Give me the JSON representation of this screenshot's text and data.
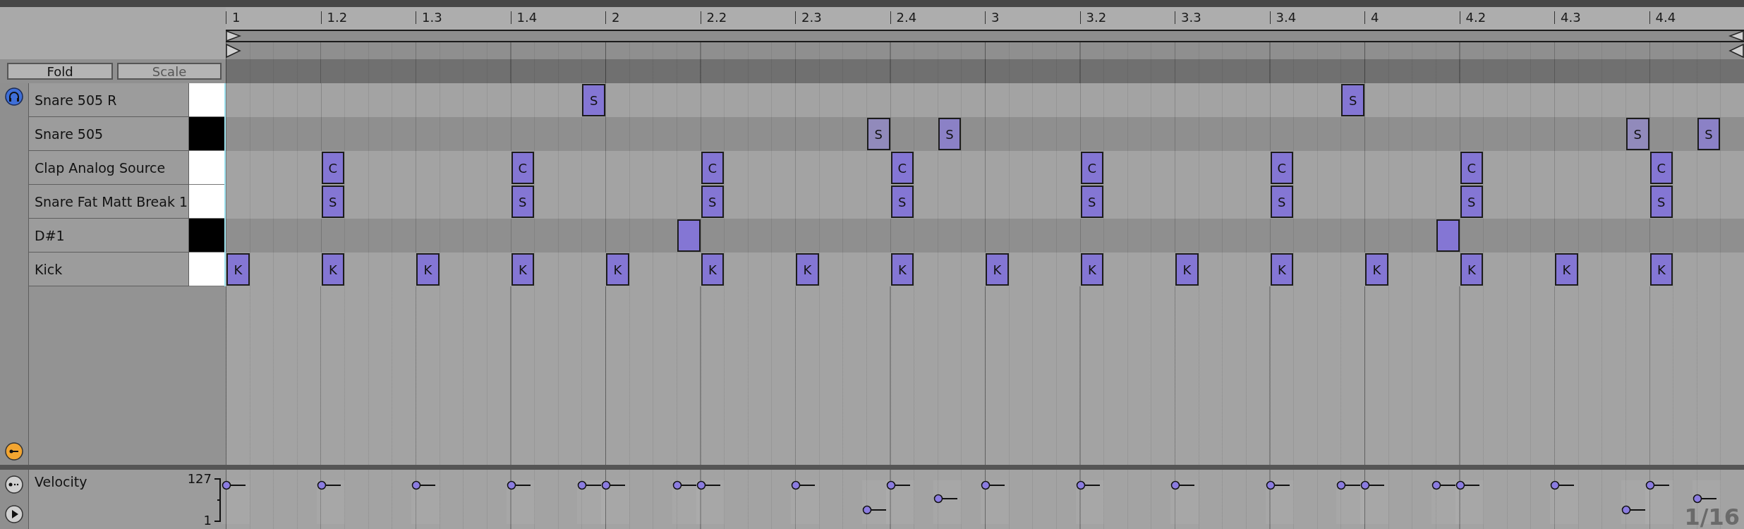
{
  "toolbar": {
    "fold_button": "Fold",
    "scale_button": "Scale"
  },
  "ruler": {
    "labels": [
      "1",
      "1.2",
      "1.3",
      "1.4",
      "2",
      "2.2",
      "2.3",
      "2.4",
      "3",
      "3.2",
      "3.3",
      "3.4",
      "4",
      "4.2",
      "4.3",
      "4.4"
    ]
  },
  "rows": [
    {
      "name": "Snare 505 R",
      "black_key": false,
      "steps": [
        {
          "note": false
        },
        {
          "note": false
        },
        {
          "note": false
        },
        {
          "note": false
        },
        {
          "note": false
        },
        {
          "note": false
        },
        {
          "note": false
        },
        {
          "note": false
        },
        {
          "note": false
        },
        {
          "note": false
        },
        {
          "note": false
        },
        {
          "note": false
        },
        {
          "note": false
        },
        {
          "note": false
        },
        {
          "note": false
        },
        {
          "note": true,
          "label": "S",
          "level": 1
        },
        {
          "note": false
        },
        {
          "note": false
        },
        {
          "note": false
        },
        {
          "note": false
        },
        {
          "note": false
        },
        {
          "note": false
        },
        {
          "note": false
        },
        {
          "note": false
        },
        {
          "note": false
        },
        {
          "note": false
        },
        {
          "note": false
        },
        {
          "note": false
        },
        {
          "note": false
        },
        {
          "note": false
        },
        {
          "note": false
        },
        {
          "note": false
        },
        {
          "note": false
        },
        {
          "note": false
        },
        {
          "note": false
        },
        {
          "note": false
        },
        {
          "note": false
        },
        {
          "note": false
        },
        {
          "note": false
        },
        {
          "note": false
        },
        {
          "note": false
        },
        {
          "note": false
        },
        {
          "note": false
        },
        {
          "note": false
        },
        {
          "note": false
        },
        {
          "note": false
        },
        {
          "note": false
        },
        {
          "note": true,
          "label": "S",
          "level": 1
        },
        {
          "note": false
        },
        {
          "note": false
        },
        {
          "note": false
        },
        {
          "note": false
        },
        {
          "note": false
        },
        {
          "note": false
        },
        {
          "note": false
        },
        {
          "note": false
        },
        {
          "note": false
        },
        {
          "note": false
        },
        {
          "note": false
        },
        {
          "note": false
        },
        {
          "note": false
        },
        {
          "note": false
        },
        {
          "note": false
        },
        {
          "note": false
        }
      ]
    },
    {
      "name": "Snare 505",
      "black_key": true,
      "steps": [
        {
          "note": false
        },
        {
          "note": false
        },
        {
          "note": false
        },
        {
          "note": false
        },
        {
          "note": false
        },
        {
          "note": false
        },
        {
          "note": false
        },
        {
          "note": false
        },
        {
          "note": false
        },
        {
          "note": false
        },
        {
          "note": false
        },
        {
          "note": false
        },
        {
          "note": false
        },
        {
          "note": false
        },
        {
          "note": false
        },
        {
          "note": false
        },
        {
          "note": false
        },
        {
          "note": false
        },
        {
          "note": false
        },
        {
          "note": false
        },
        {
          "note": false
        },
        {
          "note": false
        },
        {
          "note": false
        },
        {
          "note": false
        },
        {
          "note": false
        },
        {
          "note": false
        },
        {
          "note": false
        },
        {
          "note": true,
          "label": "S",
          "level": 0.27
        },
        {
          "note": false
        },
        {
          "note": false
        },
        {
          "note": true,
          "label": "S",
          "level": 0.6
        },
        {
          "note": false
        },
        {
          "note": false
        },
        {
          "note": false
        },
        {
          "note": false
        },
        {
          "note": false
        },
        {
          "note": false
        },
        {
          "note": false
        },
        {
          "note": false
        },
        {
          "note": false
        },
        {
          "note": false
        },
        {
          "note": false
        },
        {
          "note": false
        },
        {
          "note": false
        },
        {
          "note": false
        },
        {
          "note": false
        },
        {
          "note": false
        },
        {
          "note": false
        },
        {
          "note": false
        },
        {
          "note": false
        },
        {
          "note": false
        },
        {
          "note": false
        },
        {
          "note": false
        },
        {
          "note": false
        },
        {
          "note": false
        },
        {
          "note": false
        },
        {
          "note": false
        },
        {
          "note": false
        },
        {
          "note": false
        },
        {
          "note": true,
          "label": "S",
          "level": 0.27
        },
        {
          "note": false
        },
        {
          "note": false
        },
        {
          "note": true,
          "label": "S",
          "level": 0.6
        },
        {
          "note": false
        }
      ]
    },
    {
      "name": "Clap Analog Source",
      "black_key": false,
      "steps": [
        {
          "note": false
        },
        {
          "note": false
        },
        {
          "note": false
        },
        {
          "note": false
        },
        {
          "note": true,
          "label": "C",
          "level": 1
        },
        {
          "note": false
        },
        {
          "note": false
        },
        {
          "note": false
        },
        {
          "note": false
        },
        {
          "note": false
        },
        {
          "note": false
        },
        {
          "note": false
        },
        {
          "note": true,
          "label": "C",
          "level": 1
        },
        {
          "note": false
        },
        {
          "note": false
        },
        {
          "note": false
        },
        {
          "note": false
        },
        {
          "note": false
        },
        {
          "note": false
        },
        {
          "note": false
        },
        {
          "note": true,
          "label": "C",
          "level": 1
        },
        {
          "note": false
        },
        {
          "note": false
        },
        {
          "note": false
        },
        {
          "note": false
        },
        {
          "note": false
        },
        {
          "note": false
        },
        {
          "note": false
        },
        {
          "note": true,
          "label": "C",
          "level": 1
        },
        {
          "note": false
        },
        {
          "note": false
        },
        {
          "note": false
        },
        {
          "note": false
        },
        {
          "note": false
        },
        {
          "note": false
        },
        {
          "note": false
        },
        {
          "note": true,
          "label": "C",
          "level": 1
        },
        {
          "note": false
        },
        {
          "note": false
        },
        {
          "note": false
        },
        {
          "note": false
        },
        {
          "note": false
        },
        {
          "note": false
        },
        {
          "note": false
        },
        {
          "note": true,
          "label": "C",
          "level": 1
        },
        {
          "note": false
        },
        {
          "note": false
        },
        {
          "note": false
        },
        {
          "note": false
        },
        {
          "note": false
        },
        {
          "note": false
        },
        {
          "note": false
        },
        {
          "note": true,
          "label": "C",
          "level": 1
        },
        {
          "note": false
        },
        {
          "note": false
        },
        {
          "note": false
        },
        {
          "note": false
        },
        {
          "note": false
        },
        {
          "note": false
        },
        {
          "note": false
        },
        {
          "note": true,
          "label": "C",
          "level": 1
        },
        {
          "note": false
        },
        {
          "note": false
        },
        {
          "note": false
        }
      ]
    },
    {
      "name": "Snare Fat Matt Break 1",
      "black_key": false,
      "steps": [
        {
          "note": false
        },
        {
          "note": false
        },
        {
          "note": false
        },
        {
          "note": false
        },
        {
          "note": true,
          "label": "S",
          "level": 1
        },
        {
          "note": false
        },
        {
          "note": false
        },
        {
          "note": false
        },
        {
          "note": false
        },
        {
          "note": false
        },
        {
          "note": false
        },
        {
          "note": false
        },
        {
          "note": true,
          "label": "S",
          "level": 1
        },
        {
          "note": false
        },
        {
          "note": false
        },
        {
          "note": false
        },
        {
          "note": false
        },
        {
          "note": false
        },
        {
          "note": false
        },
        {
          "note": false
        },
        {
          "note": true,
          "label": "S",
          "level": 1
        },
        {
          "note": false
        },
        {
          "note": false
        },
        {
          "note": false
        },
        {
          "note": false
        },
        {
          "note": false
        },
        {
          "note": false
        },
        {
          "note": false
        },
        {
          "note": true,
          "label": "S",
          "level": 1
        },
        {
          "note": false
        },
        {
          "note": false
        },
        {
          "note": false
        },
        {
          "note": false
        },
        {
          "note": false
        },
        {
          "note": false
        },
        {
          "note": false
        },
        {
          "note": true,
          "label": "S",
          "level": 1
        },
        {
          "note": false
        },
        {
          "note": false
        },
        {
          "note": false
        },
        {
          "note": false
        },
        {
          "note": false
        },
        {
          "note": false
        },
        {
          "note": false
        },
        {
          "note": true,
          "label": "S",
          "level": 1
        },
        {
          "note": false
        },
        {
          "note": false
        },
        {
          "note": false
        },
        {
          "note": false
        },
        {
          "note": false
        },
        {
          "note": false
        },
        {
          "note": false
        },
        {
          "note": true,
          "label": "S",
          "level": 1
        },
        {
          "note": false
        },
        {
          "note": false
        },
        {
          "note": false
        },
        {
          "note": false
        },
        {
          "note": false
        },
        {
          "note": false
        },
        {
          "note": false
        },
        {
          "note": true,
          "label": "S",
          "level": 1
        },
        {
          "note": false
        },
        {
          "note": false
        },
        {
          "note": false
        }
      ]
    },
    {
      "name": "D#1",
      "black_key": true,
      "steps": [
        {
          "note": false
        },
        {
          "note": false
        },
        {
          "note": false
        },
        {
          "note": false
        },
        {
          "note": false
        },
        {
          "note": false
        },
        {
          "note": false
        },
        {
          "note": false
        },
        {
          "note": false
        },
        {
          "note": false
        },
        {
          "note": false
        },
        {
          "note": false
        },
        {
          "note": false
        },
        {
          "note": false
        },
        {
          "note": false
        },
        {
          "note": false
        },
        {
          "note": false
        },
        {
          "note": false
        },
        {
          "note": false
        },
        {
          "note": true,
          "level": 1
        },
        {
          "note": false
        },
        {
          "note": false
        },
        {
          "note": false
        },
        {
          "note": false
        },
        {
          "note": false
        },
        {
          "note": false
        },
        {
          "note": false
        },
        {
          "note": false
        },
        {
          "note": false
        },
        {
          "note": false
        },
        {
          "note": false
        },
        {
          "note": false
        },
        {
          "note": false
        },
        {
          "note": false
        },
        {
          "note": false
        },
        {
          "note": false
        },
        {
          "note": false
        },
        {
          "note": false
        },
        {
          "note": false
        },
        {
          "note": false
        },
        {
          "note": false
        },
        {
          "note": false
        },
        {
          "note": false
        },
        {
          "note": false
        },
        {
          "note": false
        },
        {
          "note": false
        },
        {
          "note": false
        },
        {
          "note": false
        },
        {
          "note": false
        },
        {
          "note": false
        },
        {
          "note": false
        },
        {
          "note": true,
          "level": 1
        },
        {
          "note": false
        },
        {
          "note": false
        },
        {
          "note": false
        },
        {
          "note": false
        },
        {
          "note": false
        },
        {
          "note": false
        },
        {
          "note": false
        },
        {
          "note": false
        },
        {
          "note": false
        },
        {
          "note": false
        },
        {
          "note": false
        },
        {
          "note": false
        }
      ]
    },
    {
      "name": "Kick",
      "black_key": false,
      "steps": [
        {
          "note": true,
          "label": "K",
          "level": 1
        },
        {
          "note": false
        },
        {
          "note": false
        },
        {
          "note": false
        },
        {
          "note": true,
          "label": "K",
          "level": 1
        },
        {
          "note": false
        },
        {
          "note": false
        },
        {
          "note": false
        },
        {
          "note": true,
          "label": "K",
          "level": 1
        },
        {
          "note": false
        },
        {
          "note": false
        },
        {
          "note": false
        },
        {
          "note": true,
          "label": "K",
          "level": 1
        },
        {
          "note": false
        },
        {
          "note": false
        },
        {
          "note": false
        },
        {
          "note": true,
          "label": "K",
          "level": 1
        },
        {
          "note": false
        },
        {
          "note": false
        },
        {
          "note": false
        },
        {
          "note": true,
          "label": "K",
          "level": 1
        },
        {
          "note": false
        },
        {
          "note": false
        },
        {
          "note": false
        },
        {
          "note": true,
          "label": "K",
          "level": 1
        },
        {
          "note": false
        },
        {
          "note": false
        },
        {
          "note": false
        },
        {
          "note": true,
          "label": "K",
          "level": 1
        },
        {
          "note": false
        },
        {
          "note": false
        },
        {
          "note": false
        },
        {
          "note": true,
          "label": "K",
          "level": 1
        },
        {
          "note": false
        },
        {
          "note": false
        },
        {
          "note": false
        },
        {
          "note": true,
          "label": "K",
          "level": 1
        },
        {
          "note": false
        },
        {
          "note": false
        },
        {
          "note": false
        },
        {
          "note": true,
          "label": "K",
          "level": 1
        },
        {
          "note": false
        },
        {
          "note": false
        },
        {
          "note": false
        },
        {
          "note": true,
          "label": "K",
          "level": 1
        },
        {
          "note": false
        },
        {
          "note": false
        },
        {
          "note": false
        },
        {
          "note": true,
          "label": "K",
          "level": 1
        },
        {
          "note": false
        },
        {
          "note": false
        },
        {
          "note": false
        },
        {
          "note": true,
          "label": "K",
          "level": 1
        },
        {
          "note": false
        },
        {
          "note": false
        },
        {
          "note": false
        },
        {
          "note": true,
          "label": "K",
          "level": 1
        },
        {
          "note": false
        },
        {
          "note": false
        },
        {
          "note": false
        },
        {
          "note": true,
          "label": "K",
          "level": 1
        },
        {
          "note": false
        },
        {
          "note": false
        },
        {
          "note": false
        }
      ]
    }
  ],
  "velocity": {
    "label": "Velocity",
    "max": "127",
    "min": "1"
  },
  "grid_label": "1/16"
}
